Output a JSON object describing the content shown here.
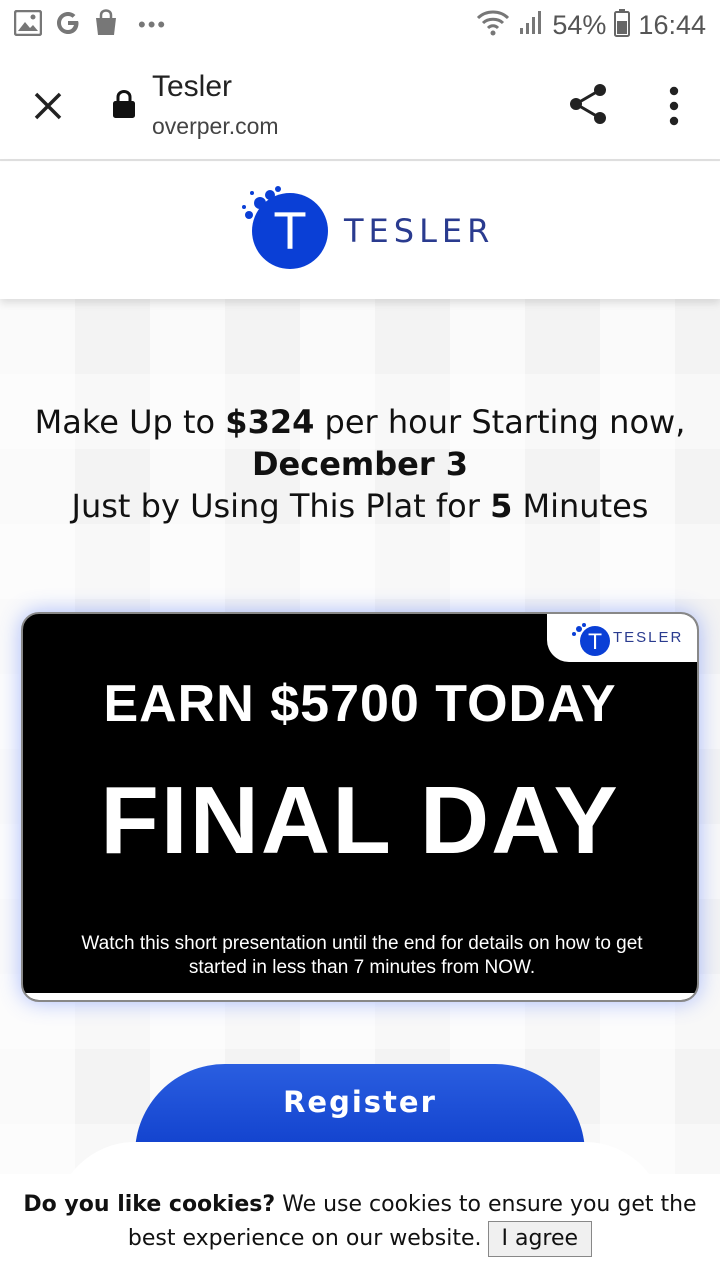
{
  "status_bar": {
    "battery_percent": "54%",
    "time": "16:44",
    "overflow_dots": "•••",
    "icons": [
      "gallery-icon",
      "google-icon",
      "shopping-bag-icon",
      "wifi-icon",
      "signal-icon",
      "battery-icon"
    ]
  },
  "browser": {
    "page_title": "Tesler",
    "url": "overper.com",
    "icons": [
      "close-icon",
      "lock-icon",
      "share-icon",
      "more-vert-icon"
    ]
  },
  "header": {
    "logo_letter": "T",
    "logo_text": "TESLER",
    "brand_color": "#0a3fd6"
  },
  "hero": {
    "line1_pre": "Make Up to ",
    "line1_amount": "$324",
    "line1_post": " per hour Starting now,",
    "line2_date": "December 3",
    "line3_pre": "Just by Using This Plat for ",
    "line3_num": "5",
    "line3_post": " Minutes"
  },
  "promo": {
    "mini_logo_letter": "T",
    "mini_logo_text": "TESLER",
    "earn_text": "EARN $5700 TODAY",
    "final_text": "FINAL DAY",
    "watch_text": "Watch this short presentation until the end for details on how to get started in less than 7 minutes from NOW."
  },
  "cta": {
    "register_label": "Register",
    "button_color": "#1247d4"
  },
  "cookie": {
    "question": "Do you like cookies?",
    "message": " We use cookies to ensure you get the best experience on our website.",
    "agree_label": "I agree"
  }
}
